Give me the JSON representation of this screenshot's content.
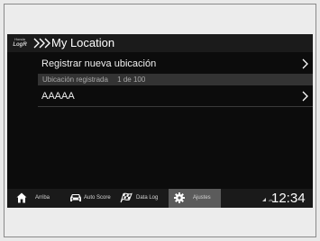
{
  "header": {
    "logo_line1": "Honda",
    "logo_line2": "LogR",
    "title": "My Location"
  },
  "list": {
    "register_label": "Registrar nueva ubicación",
    "section_label": "Ubicación registrada",
    "section_count": "1 de 100",
    "items": [
      {
        "label": "AAAAA"
      }
    ]
  },
  "nav": {
    "items": [
      {
        "label": "Arriba",
        "icon": "home-icon"
      },
      {
        "label": "Auto Score",
        "icon": "car-icon"
      },
      {
        "label": "Data Log",
        "icon": "checkered-flag-icon"
      },
      {
        "label": "Ajustes",
        "icon": "gear-icon",
        "selected": true
      }
    ]
  },
  "status": {
    "time": "12:34"
  },
  "colors": {
    "screen_bg": "#0c0c0c",
    "section_bg": "#333333",
    "nav_selected_bg": "#5b5b5b"
  }
}
